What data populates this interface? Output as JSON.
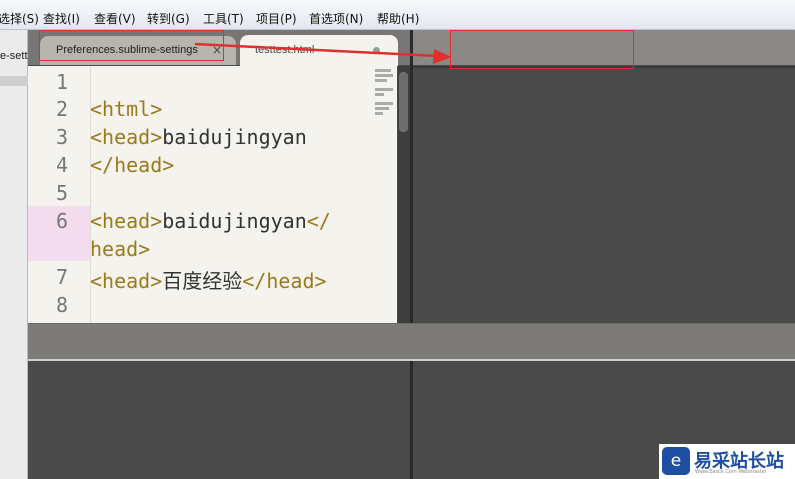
{
  "menu": {
    "items": [
      "选择(S)",
      "查找(I)",
      "查看(V)",
      "转到(G)",
      "工具(T)",
      "项目(P)",
      "首选项(N)",
      "帮助(H)"
    ]
  },
  "left_strip": {
    "tab_fragment": "e-sett"
  },
  "tabs": [
    {
      "label": "Preferences.sublime-settings",
      "close": "×"
    },
    {
      "label": "testtest.html"
    }
  ],
  "editor": {
    "line_numbers": [
      "1",
      "2",
      "3",
      "4",
      "5",
      "6",
      "7",
      "8"
    ],
    "lines": [
      {
        "tag1": "",
        "text": "",
        "tag2": ""
      },
      {
        "tag1": "<html>",
        "text": "",
        "tag2": ""
      },
      {
        "tag1": "<head>",
        "text": "baidujingyan",
        "tag2": ""
      },
      {
        "tag1": "</head>",
        "text": "",
        "tag2": ""
      },
      {
        "tag1": "",
        "text": "",
        "tag2": ""
      },
      {
        "tag1": "<head>",
        "text": "baidujingyan",
        "tag2": "</"
      },
      {
        "tag1": "head>",
        "text": "",
        "tag2": ""
      },
      {
        "tag1": "<head>",
        "text": "百度经验",
        "tag2": "</head>"
      },
      {
        "tag1": "",
        "text": "",
        "tag2": ""
      }
    ]
  },
  "watermark": {
    "logo": "e",
    "text": "易采站长站",
    "sub": "Www.Easck.Com  Webmaster"
  },
  "colors": {
    "tag": "#9b7a1b",
    "highlight": "#f2dcee",
    "annotation": "#e0302d"
  }
}
